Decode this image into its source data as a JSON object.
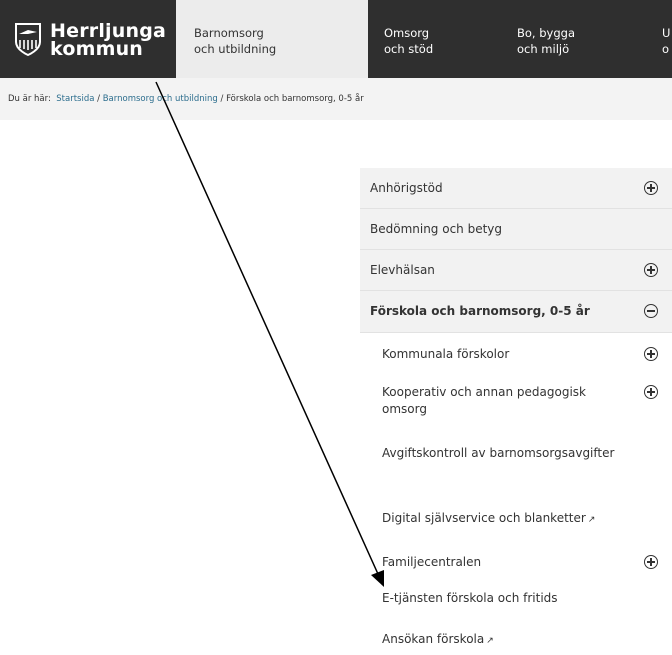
{
  "logo": {
    "line1": "Herrljunga",
    "line2": "kommun"
  },
  "nav": [
    {
      "line1": "Barnomsorg",
      "line2": "och utbildning",
      "active": true
    },
    {
      "line1": "Omsorg",
      "line2": "och stöd"
    },
    {
      "line1": "Bo, bygga",
      "line2": "och miljö"
    },
    {
      "line1": "U",
      "line2": "o"
    }
  ],
  "breadcrumb": {
    "prefix": "Du är här:",
    "items": [
      "Startsida",
      "Barnomsorg och utbildning"
    ],
    "separator": "/",
    "current": "Förskola och barnomsorg, 0-5 år"
  },
  "menu": {
    "items": [
      {
        "label": "Anhörigstöd",
        "toggle": "plus-icon"
      },
      {
        "label": "Bedömning och betyg"
      },
      {
        "label": "Elevhälsan",
        "toggle": "plus-icon"
      },
      {
        "label": "Förskola och barnomsorg, 0-5 år",
        "toggle": "minus-icon",
        "expanded": true
      },
      {
        "label": "Kommunala förskolor",
        "toggle": "plus-icon"
      },
      {
        "label": "Kooperativ och annan pedagogisk omsorg",
        "toggle": "plus-icon"
      },
      {
        "label": "Avgiftskontroll av barnomsorgsavgifter"
      },
      {
        "label": "Digital självservice och blanketter",
        "icon": "external-link-icon"
      },
      {
        "label": "Familjecentralen",
        "toggle": "plus-icon"
      },
      {
        "label": "E-tjänsten förskola och fritids"
      },
      {
        "label": "Ansökan förskola",
        "icon": "external-link-icon"
      }
    ]
  },
  "colors": {
    "header_bg": "#2f2f2f",
    "active_tab_bg": "#ececec",
    "link": "#2d6e8e",
    "menu_bg": "#f2f2f2"
  }
}
